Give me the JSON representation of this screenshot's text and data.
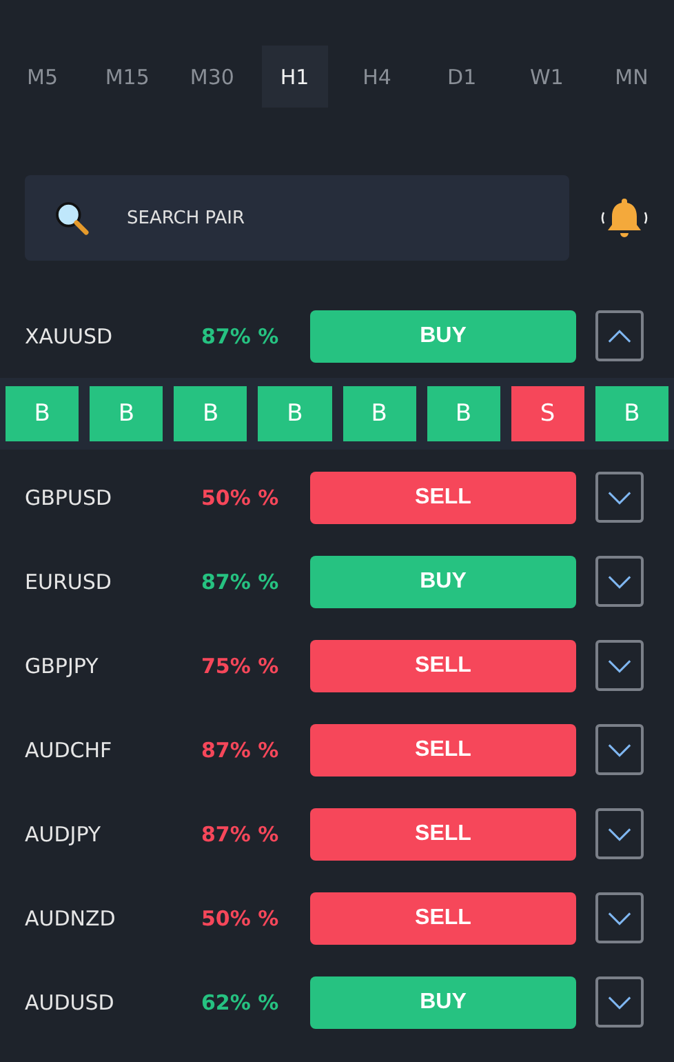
{
  "timeframes": [
    {
      "label": "M5",
      "selected": false
    },
    {
      "label": "M15",
      "selected": false
    },
    {
      "label": "M30",
      "selected": false
    },
    {
      "label": "H1",
      "selected": true
    },
    {
      "label": "H4",
      "selected": false
    },
    {
      "label": "D1",
      "selected": false
    },
    {
      "label": "W1",
      "selected": false
    },
    {
      "label": "MN",
      "selected": false
    }
  ],
  "search": {
    "placeholder": "SEARCH PAIR"
  },
  "pairs": [
    {
      "pair": "XAUUSD",
      "percent": "87% %",
      "kind": "buy",
      "action": "BUY",
      "expanded": true,
      "timeframe_signals": [
        {
          "label": "B",
          "kind": "buy"
        },
        {
          "label": "B",
          "kind": "buy"
        },
        {
          "label": "B",
          "kind": "buy"
        },
        {
          "label": "B",
          "kind": "buy"
        },
        {
          "label": "B",
          "kind": "buy"
        },
        {
          "label": "B",
          "kind": "buy"
        },
        {
          "label": "S",
          "kind": "sell"
        },
        {
          "label": "B",
          "kind": "buy"
        }
      ]
    },
    {
      "pair": "GBPUSD",
      "percent": "50% %",
      "kind": "sell",
      "action": "SELL",
      "expanded": false
    },
    {
      "pair": "EURUSD",
      "percent": "87% %",
      "kind": "buy",
      "action": "BUY",
      "expanded": false
    },
    {
      "pair": "GBPJPY",
      "percent": "75% %",
      "kind": "sell",
      "action": "SELL",
      "expanded": false
    },
    {
      "pair": "AUDCHF",
      "percent": "87% %",
      "kind": "sell",
      "action": "SELL",
      "expanded": false
    },
    {
      "pair": "AUDJPY",
      "percent": "87% %",
      "kind": "sell",
      "action": "SELL",
      "expanded": false
    },
    {
      "pair": "AUDNZD",
      "percent": "50% %",
      "kind": "sell",
      "action": "SELL",
      "expanded": false
    },
    {
      "pair": "AUDUSD",
      "percent": "62% %",
      "kind": "buy",
      "action": "BUY",
      "expanded": false
    }
  ]
}
